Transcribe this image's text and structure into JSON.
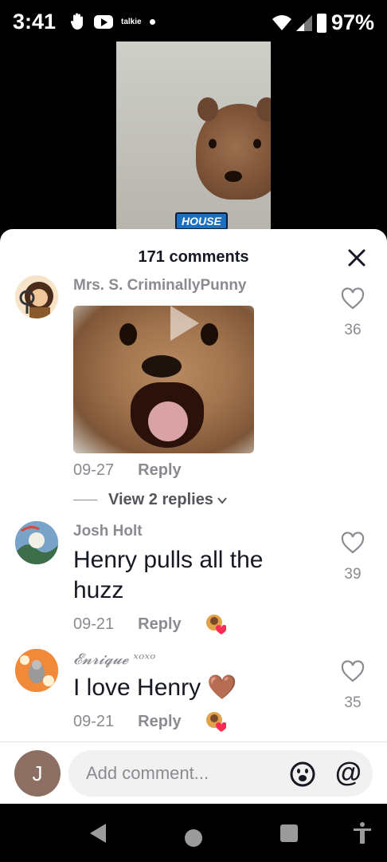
{
  "status_bar": {
    "time": "3:41",
    "app_label": "talkie",
    "battery": "97%"
  },
  "video": {
    "caption": "HOUSE"
  },
  "comments_sheet": {
    "title": "171 comments",
    "comments": [
      {
        "username": "Mrs. S. CriminallyPunny",
        "text": "",
        "date": "09-27",
        "reply_label": "Reply",
        "likes": "36",
        "view_replies": "View 2 replies"
      },
      {
        "username": "Josh Holt",
        "text": "Henry pulls all the huzz",
        "date": "09-21",
        "reply_label": "Reply",
        "likes": "39"
      },
      {
        "username": "𝓔𝓷𝓻𝓲𝓺𝓾𝓮 ˣᵒˣᵒ",
        "text": "I love Henry 🤎",
        "date": "09-21",
        "reply_label": "Reply",
        "likes": "35"
      }
    ]
  },
  "input_bar": {
    "avatar_initial": "J",
    "placeholder": "Add comment...",
    "mention_symbol": "@"
  },
  "colors": {
    "sheet_bg": "#ffffff",
    "muted_text": "#8a8b91",
    "primary_text": "#161823",
    "like_red": "#fe2c55"
  },
  "icons": [
    "hand-icon",
    "youtube-icon",
    "wifi-icon",
    "signal-icon",
    "battery-icon",
    "close-icon",
    "heart-icon",
    "play-icon",
    "chevron-down-icon",
    "emoji-icon",
    "at-icon",
    "back-icon",
    "home-icon",
    "recents-icon",
    "accessibility-icon"
  ]
}
